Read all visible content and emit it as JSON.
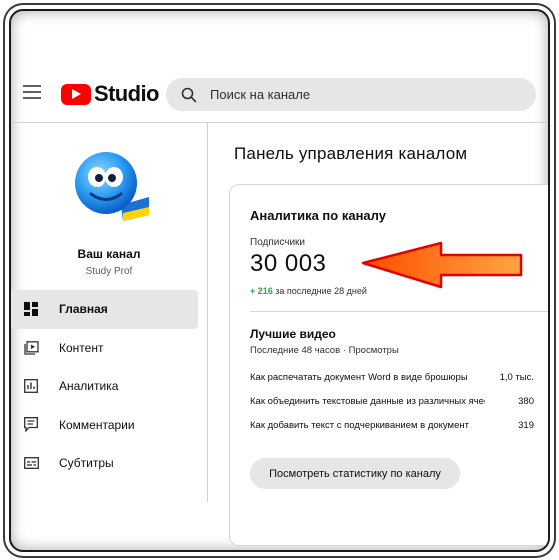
{
  "header": {
    "brand": "Studio",
    "search_placeholder": "Поиск на канале"
  },
  "sidebar": {
    "channel_name": "Ваш канал",
    "channel_handle": "Study Prof",
    "items": [
      {
        "label": "Главная",
        "icon": "dashboard-icon",
        "active": true
      },
      {
        "label": "Контент",
        "icon": "content-icon",
        "active": false
      },
      {
        "label": "Аналитика",
        "icon": "analytics-icon",
        "active": false
      },
      {
        "label": "Комментарии",
        "icon": "comments-icon",
        "active": false
      },
      {
        "label": "Субтитры",
        "icon": "subtitles-icon",
        "active": false
      }
    ]
  },
  "main": {
    "title": "Панель управления каналом",
    "card": {
      "title": "Аналитика по каналу",
      "subscribers_label": "Подписчики",
      "subscribers_value": "30 003",
      "delta_value": "+ 216",
      "delta_text": "за последние 28 дней",
      "top_videos_title": "Лучшие видео",
      "top_videos_subtitle": "Последние 48 часов · Просмотры",
      "videos": [
        {
          "title": "Как распечатать документ Word в виде брошюры",
          "views": "1,0 тыс."
        },
        {
          "title": "Как объединить текстовые данные из различных ячеек",
          "views": "380"
        },
        {
          "title": "Как добавить текст с подчеркиванием в документ",
          "views": "319"
        }
      ],
      "stats_button": "Посмотреть статистику по каналу"
    }
  },
  "colors": {
    "brand_red": "#ff0000",
    "delta_green": "#2ba640",
    "arrow_fill": "#ff6a1a",
    "arrow_stroke": "#e60000"
  }
}
